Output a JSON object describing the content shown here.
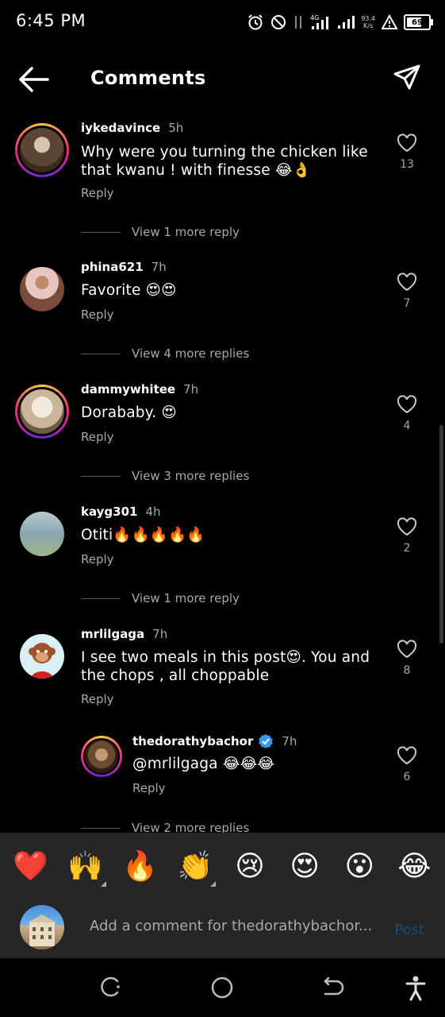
{
  "status": {
    "time": "6:45 PM",
    "network": "4G",
    "speed_value": "93.4",
    "speed_unit": "K/s",
    "battery": "69"
  },
  "header": {
    "title": "Comments"
  },
  "comments": [
    {
      "username": "iykedavince",
      "time": "5h",
      "text": "Why were you turning the chicken like that kwanu ! with finesse 😂👌",
      "reply": "Reply",
      "likes": "13",
      "view_more": "View 1 more reply",
      "avatar_color": "#5a4632"
    },
    {
      "username": "phina621",
      "time": "7h",
      "text": "Favorite 😍😍",
      "reply": "Reply",
      "likes": "7",
      "view_more": "View 4 more replies",
      "avatar_color": "#7a4a3a"
    },
    {
      "username": "dammywhitee",
      "time": "7h",
      "text": "Dorababy. 😍",
      "reply": "Reply",
      "likes": "4",
      "view_more": "View 3 more replies",
      "avatar_color": "#c9b59a"
    },
    {
      "username": "kayg301",
      "time": "4h",
      "text": "Otiti🔥🔥🔥🔥🔥",
      "reply": "Reply",
      "likes": "2",
      "view_more": "View 1 more reply",
      "avatar_color": "#8aa6b0"
    },
    {
      "username": "mrlilgaga",
      "time": "7h",
      "text": "I see two meals in this post😍. You and the chops , all choppable",
      "reply": "Reply",
      "likes": "8",
      "avatar_color": "#d9f0f5"
    }
  ],
  "nested_reply": {
    "username": "thedorathybachor",
    "time": "7h",
    "text": "@mrlilgaga 😂😂😂",
    "reply": "Reply",
    "likes": "6",
    "view_more": "View 2 more replies",
    "avatar_color": "#6a4a30"
  },
  "reactions": [
    "❤️",
    "🙌",
    "🔥",
    "👏",
    "😢",
    "😍",
    "😮",
    "😂"
  ],
  "compose": {
    "placeholder": "Add a comment for thedorathybachor...",
    "post_label": "Post"
  },
  "colors": {
    "background": "#000000",
    "panel": "#262626",
    "muted": "#a8a8a8",
    "verified": "#3897f0",
    "post_disabled": "#1a4a7a"
  }
}
